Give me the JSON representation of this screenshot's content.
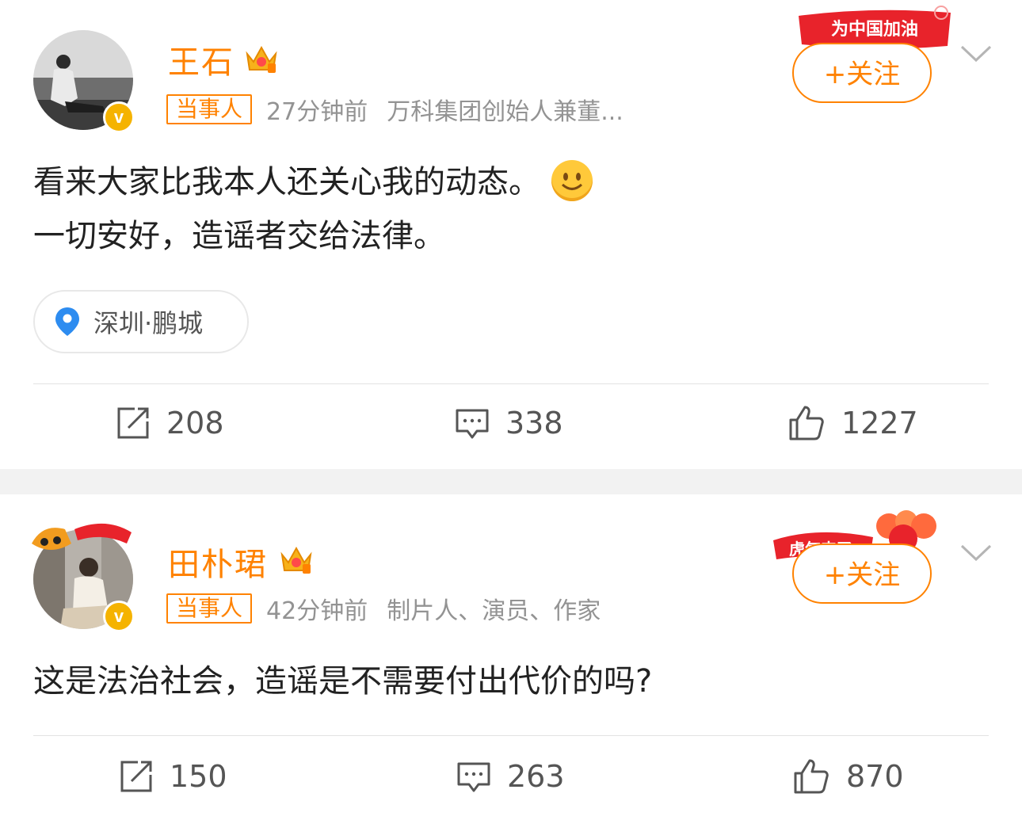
{
  "posts": [
    {
      "author": "王石",
      "tag": "当事人",
      "time": "27分钟前",
      "desc": "万科集团创始人兼董...",
      "follow_label": "+关注",
      "banner_text": "为中国加油",
      "content_line1": "看来大家比我本人还关心我的动态。",
      "content_line2": "一切安好，造谣者交给法律。",
      "location": "深圳·鹏城",
      "reposts": "208",
      "comments": "338",
      "likes": "1227"
    },
    {
      "author": "田朴珺",
      "tag": "当事人",
      "time": "42分钟前",
      "desc": "制片人、演员、作家",
      "follow_label": "+关注",
      "banner_text": "虎气来了",
      "content_line1": "这是法治社会，造谣是不需要付出代价的吗?",
      "reposts": "150",
      "comments": "263",
      "likes": "870"
    }
  ],
  "colors": {
    "accent": "#ff8200",
    "verified": "#f5b300",
    "banner_red": "#e8232b"
  },
  "icons": [
    "crown-icon",
    "verified-icon",
    "chevron-down-icon",
    "location-pin-icon",
    "repost-icon",
    "comment-icon",
    "like-icon"
  ]
}
